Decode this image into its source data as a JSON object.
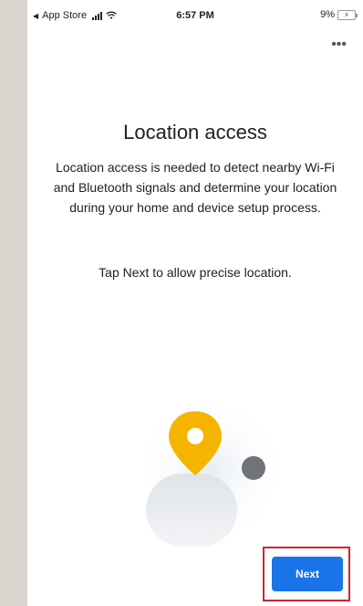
{
  "status_bar": {
    "back_app": "App Store",
    "time": "6:57 PM",
    "battery": "9%"
  },
  "menu": {
    "more_label": "•••"
  },
  "main": {
    "title": "Location access",
    "description": "Location access is needed to detect nearby Wi-Fi and Bluetooth signals and determine your location during your home and device setup process.",
    "hint": "Tap Next to allow precise location."
  },
  "actions": {
    "next_label": "Next"
  },
  "colors": {
    "accent": "#1a73e8",
    "pin": "#f4b400",
    "highlight": "#d0252f"
  }
}
